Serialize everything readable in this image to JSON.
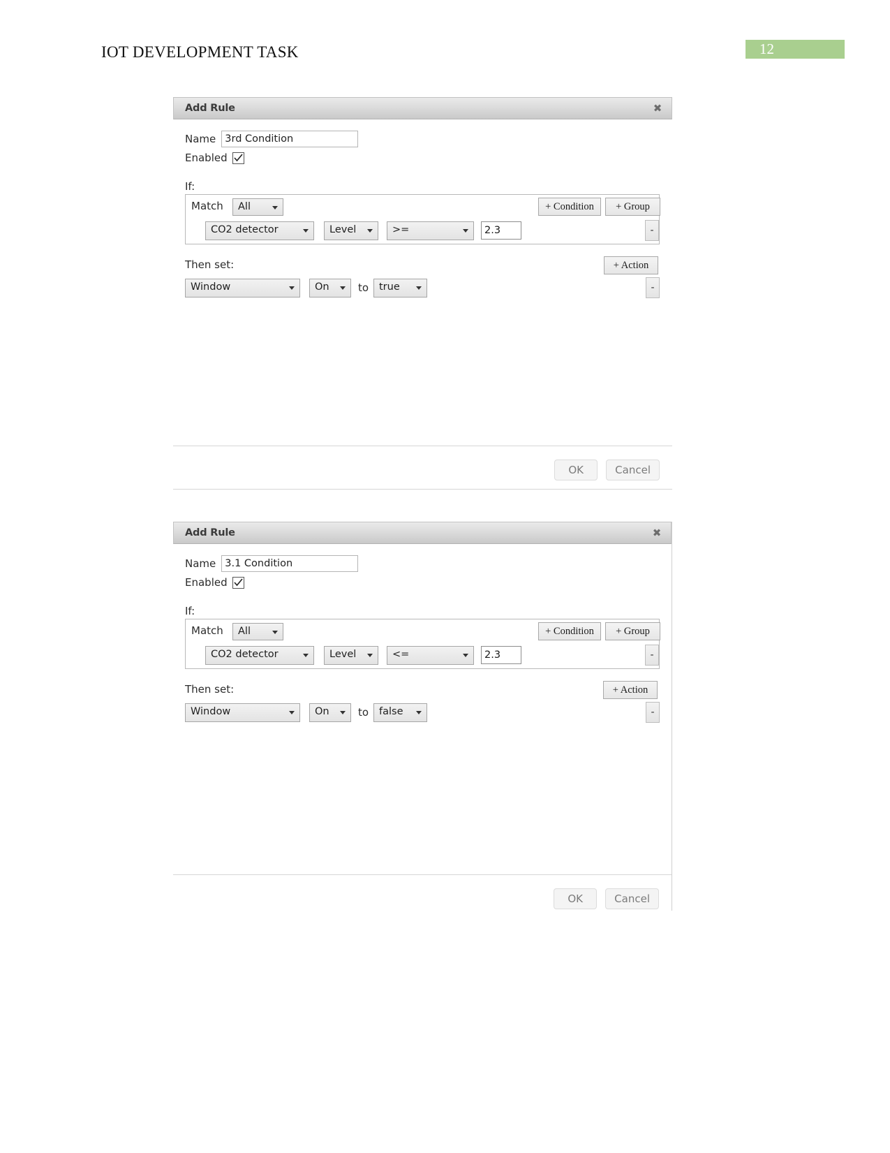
{
  "document": {
    "header_title": "IOT DEVELOPMENT TASK",
    "page_number": "12"
  },
  "dialogs": [
    {
      "title": "Add Rule",
      "close_icon": "✖",
      "name_label": "Name",
      "name_value": "3rd Condition",
      "enabled_label": "Enabled",
      "enabled_checked": true,
      "if_label": "If:",
      "match_label": "Match",
      "match_value": "All",
      "add_condition_label": "+ Condition",
      "add_group_label": "+ Group",
      "condition": {
        "device": "CO2 detector",
        "property": "Level",
        "operator": ">=",
        "value": "2.3",
        "remove_label": "-"
      },
      "then_label": "Then set:",
      "add_action_label": "+ Action",
      "action": {
        "device": "Window",
        "property": "On",
        "to_label": "to",
        "value": "true",
        "remove_label": "-"
      },
      "ok_label": "OK",
      "cancel_label": "Cancel"
    },
    {
      "title": "Add Rule",
      "close_icon": "✖",
      "name_label": "Name",
      "name_value": "3.1 Condition",
      "enabled_label": "Enabled",
      "enabled_checked": true,
      "if_label": "If:",
      "match_label": "Match",
      "match_value": "All",
      "add_condition_label": "+ Condition",
      "add_group_label": "+ Group",
      "condition": {
        "device": "CO2 detector",
        "property": "Level",
        "operator": "<=",
        "value": "2.3",
        "remove_label": "-"
      },
      "then_label": "Then set:",
      "add_action_label": "+ Action",
      "action": {
        "device": "Window",
        "property": "On",
        "to_label": "to",
        "value": "false",
        "remove_label": "-"
      },
      "ok_label": "OK",
      "cancel_label": "Cancel"
    }
  ],
  "colors": {
    "page_badge_bg": "#a9cf8f",
    "titlebar_bg": "#dcdcdc",
    "control_bg": "#e6e6e6"
  }
}
